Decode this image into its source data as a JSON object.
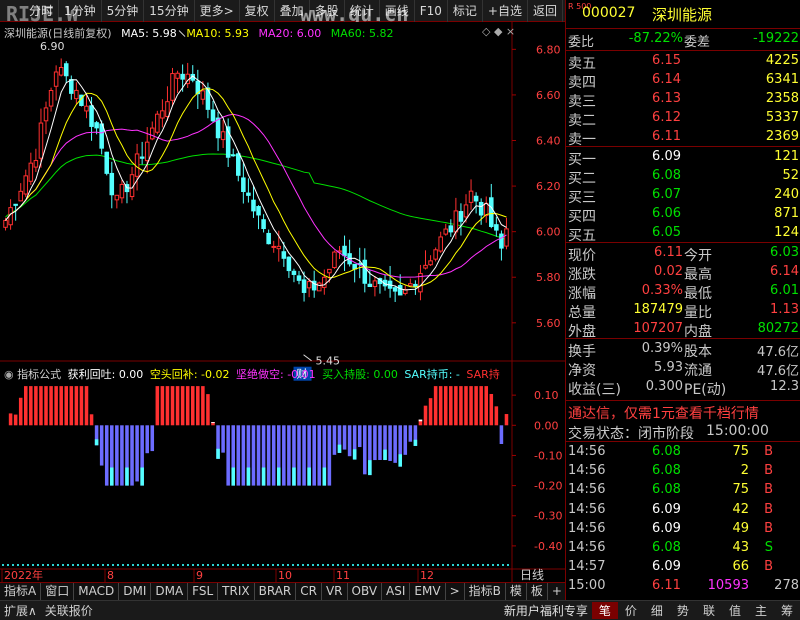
{
  "toolbar": {
    "items": [
      "分时",
      "1分钟",
      "5分钟",
      "15分钟",
      "更多>",
      "复权",
      "叠加",
      "多股",
      "统计",
      "画线",
      "F10",
      "标记",
      "+自选",
      "返回"
    ]
  },
  "watermark": {
    "left": "RIJE.W",
    "right": "www.gu.cn"
  },
  "chart_header": {
    "name": "深圳能源(日线前复权)",
    "ma5": "MA5: 5.98",
    "ma10": "MA10: 5.93",
    "ma20": "MA20: 6.00",
    "ma60": "MA60: 5.82"
  },
  "colors": {
    "up": "#ff3030",
    "down": "#54ffff",
    "ma5": "#ffffff",
    "ma10": "#ffff00",
    "ma20": "#ff33ff",
    "ma60": "#00e000",
    "neg_bar": "#6c6cff"
  },
  "chart_data": [
    {
      "type": "candlestick",
      "title": "深圳能源(日线前复权)",
      "y_ticks": [
        "6.80",
        "6.60",
        "6.40",
        "6.20",
        "6.00",
        "5.80",
        "5.60"
      ],
      "ylim": [
        5.45,
        6.92
      ],
      "high_label": "6.90",
      "low_label": "5.45",
      "event_label": "财",
      "series": [
        {
          "name": "MA5",
          "value": 5.98
        },
        {
          "name": "MA10",
          "value": 5.93
        },
        {
          "name": "MA20",
          "value": 6.0
        },
        {
          "name": "MA60",
          "value": 5.82
        }
      ]
    },
    {
      "type": "bar",
      "title": "指标公式",
      "series": [
        {
          "name": "获利回吐",
          "value": "0.00"
        },
        {
          "name": "空头回补",
          "value": "-0.02"
        },
        {
          "name": "坚绝做空",
          "value": "-0.01"
        },
        {
          "name": "买入持股",
          "value": "0.00"
        },
        {
          "name": "SAR持币",
          "value": "-"
        },
        {
          "name": "SAR持",
          "value": ""
        }
      ],
      "y_ticks": [
        "0.10",
        "0.00",
        "-0.10",
        "-0.20",
        "-0.30",
        "-0.40"
      ],
      "ylim": [
        -0.47,
        0.2
      ]
    }
  ],
  "x_axis": [
    "2022年",
    "8",
    "9",
    "10",
    "11",
    "12"
  ],
  "indicator_tabs": [
    "指标A",
    "窗口",
    "MACD",
    "DMI",
    "DMA",
    "FSL",
    "TRIX",
    "BRAR",
    "CR",
    "VR",
    "OBV",
    "ASI",
    "EMV",
    ">",
    "指标B",
    "模",
    "板",
    "+",
    "-"
  ],
  "right_tab_label": "日线",
  "statusbar": {
    "left": [
      "扩展∧",
      "关联报价"
    ],
    "right_text": "新用户福利专享",
    "right_tabs": [
      "笔",
      "价",
      "细",
      "势",
      "联",
      "值",
      "主",
      "筹"
    ]
  },
  "quote": {
    "code": "000027",
    "name": "深圳能源",
    "badge": "R 500",
    "weibi_label": "委比",
    "weibi": "-87.22%",
    "weicha_label": "委差",
    "weicha": "-19222",
    "asks": [
      {
        "label": "卖五",
        "price": "6.15",
        "vol": "4225"
      },
      {
        "label": "卖四",
        "price": "6.14",
        "vol": "6341"
      },
      {
        "label": "卖三",
        "price": "6.13",
        "vol": "2358"
      },
      {
        "label": "卖二",
        "price": "6.12",
        "vol": "5337"
      },
      {
        "label": "卖一",
        "price": "6.11",
        "vol": "2369"
      }
    ],
    "bids": [
      {
        "label": "买一",
        "price": "6.09",
        "vol": "121"
      },
      {
        "label": "买二",
        "price": "6.08",
        "vol": "52"
      },
      {
        "label": "买三",
        "price": "6.07",
        "vol": "240"
      },
      {
        "label": "买四",
        "price": "6.06",
        "vol": "871"
      },
      {
        "label": "买五",
        "price": "6.05",
        "vol": "124"
      }
    ],
    "stats": [
      {
        "l1": "现价",
        "v1": "6.11",
        "l2": "今开",
        "v2": "6.03"
      },
      {
        "l1": "涨跌",
        "v1": "0.02",
        "l2": "最高",
        "v2": "6.14"
      },
      {
        "l1": "涨幅",
        "v1": "0.33%",
        "l2": "最低",
        "v2": "6.01"
      },
      {
        "l1": "总量",
        "v1": "187479",
        "l2": "量比",
        "v2": "1.13"
      },
      {
        "l1": "外盘",
        "v1": "107207",
        "l2": "内盘",
        "v2": "80272"
      }
    ],
    "fin": [
      {
        "l1": "换手",
        "v1": "0.39%",
        "l2": "股本",
        "v2": "47.6亿"
      },
      {
        "l1": "净资",
        "v1": "5.93",
        "l2": "流通",
        "v2": "47.6亿"
      },
      {
        "l1": "收益(三)",
        "v1": "0.300",
        "l2": "PE(动)",
        "v2": "12.3"
      }
    ],
    "ad": "通达信，仅需1元查看千档行情",
    "trade_state": "交易状态：闭市阶段",
    "trade_time": "15:00:00",
    "ticks": [
      {
        "t": "14:56",
        "p": "6.08",
        "v": "75",
        "s": "B"
      },
      {
        "t": "14:56",
        "p": "6.08",
        "v": "2",
        "s": "B"
      },
      {
        "t": "14:56",
        "p": "6.08",
        "v": "75",
        "s": "B"
      },
      {
        "t": "14:56",
        "p": "6.09",
        "v": "42",
        "s": "B"
      },
      {
        "t": "14:56",
        "p": "6.09",
        "v": "49",
        "s": "B"
      },
      {
        "t": "14:56",
        "p": "6.08",
        "v": "43",
        "s": "S"
      },
      {
        "t": "14:57",
        "p": "6.09",
        "v": "66",
        "s": "B"
      },
      {
        "t": "15:00",
        "p": "6.11",
        "v": "10593",
        "s": "278"
      }
    ]
  }
}
